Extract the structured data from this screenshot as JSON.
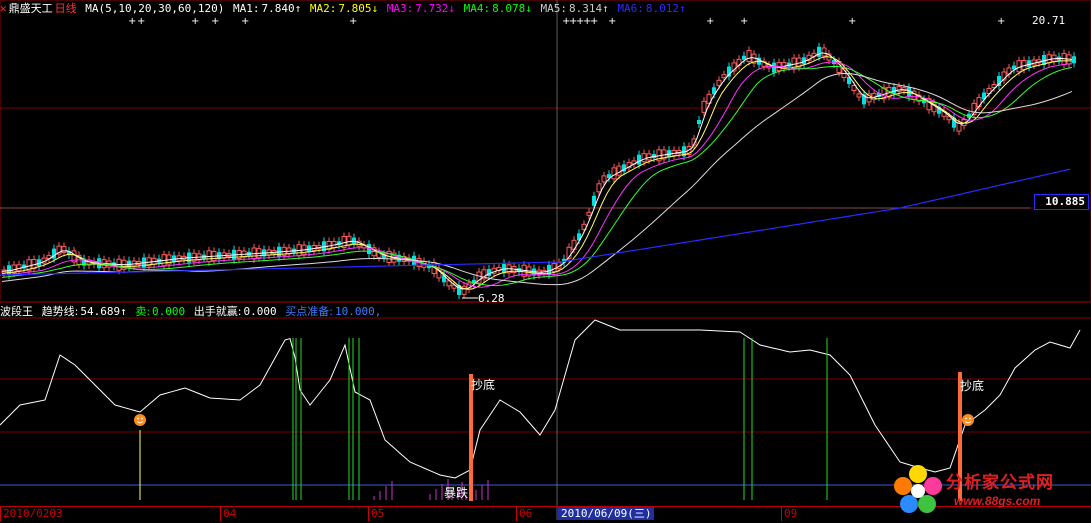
{
  "top_panel": {
    "close_icon": "close-icon",
    "stock_name": "鼎盛天工",
    "period": "日线",
    "ma_params": "MA(5,10,20,30,60,120)",
    "ma1": {
      "label": "MA1:",
      "value": "7.840↑",
      "color": "#ffffff"
    },
    "ma2": {
      "label": "MA2:",
      "value": "7.805↓",
      "color": "#ffff00"
    },
    "ma3": {
      "label": "MA3:",
      "value": "7.732↓",
      "color": "#ff00ff"
    },
    "ma4": {
      "label": "MA4:",
      "value": "8.078↓",
      "color": "#00ff00"
    },
    "ma5": {
      "label": "MA5:",
      "value": "8.314↑",
      "color": "#cccccc"
    },
    "ma6": {
      "label": "MA6:",
      "value": "8.012↑",
      "color": "#2a2aff"
    },
    "high_label": "20.71",
    "low_label": "6.28",
    "current_price": "10.885"
  },
  "bottom_panel": {
    "indicator_name": "波段王",
    "trend_line": {
      "label": "趋势线:",
      "value": "54.689↑",
      "color": "#ffffff"
    },
    "sell": {
      "label": "卖:",
      "value": "0.000",
      "color": "#00ff00"
    },
    "shot_win": {
      "label": "出手就赢:",
      "value": "0.000",
      "color": "#ffffff"
    },
    "buy_ready": {
      "label": "买点准备:",
      "value": "10.000,",
      "color": "#3a7aff"
    },
    "signal_bottom_1": "抄底",
    "signal_bottom_2": "抄底",
    "signal_drop": "暴跌"
  },
  "time_axis": {
    "labels": [
      "2010/0203",
      "04",
      "05",
      "06",
      "2010/06/09(三)",
      "09"
    ],
    "cursor_date": "2010/06/09(三)"
  },
  "watermark": {
    "name": "分析家公式网",
    "url": "www.88gs.com"
  }
}
